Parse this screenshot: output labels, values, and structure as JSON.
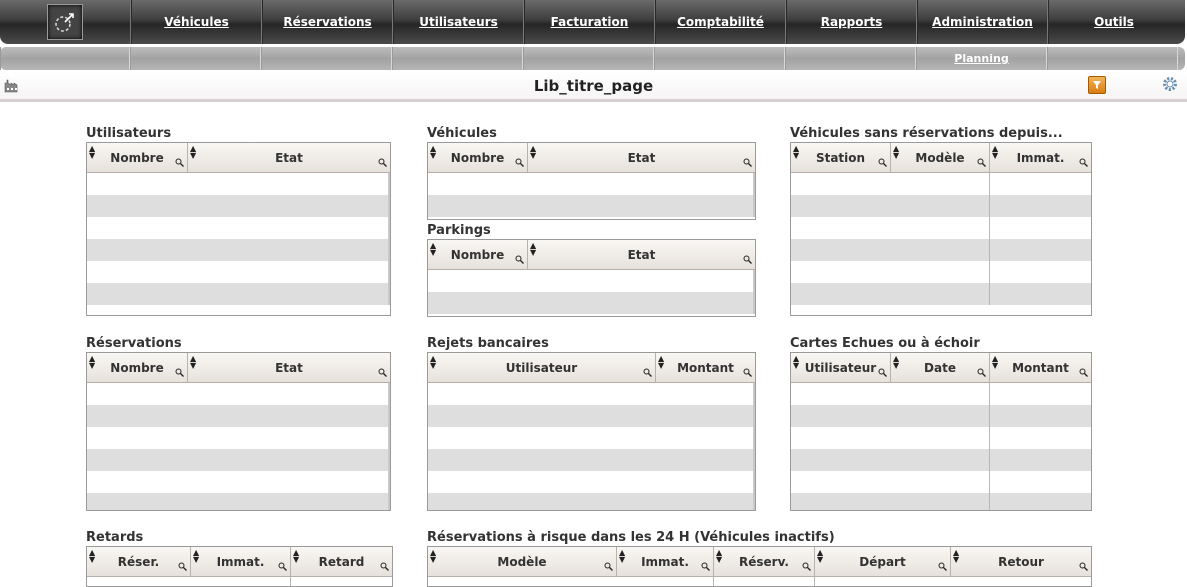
{
  "nav": {
    "items": [
      "Véhicules",
      "Réservations",
      "Utilisateurs",
      "Facturation",
      "Comptabilité",
      "Rapports",
      "Administration",
      "Outils"
    ]
  },
  "subnav": {
    "planning": "Planning"
  },
  "page": {
    "title": "Lib_titre_page"
  },
  "panels": {
    "utilisateurs": {
      "title": "Utilisateurs",
      "cols": [
        "Nombre",
        "Etat"
      ]
    },
    "vehicules": {
      "title": "Véhicules",
      "cols": [
        "Nombre",
        "Etat"
      ]
    },
    "parkings": {
      "title": "Parkings",
      "cols": [
        "Nombre",
        "Etat"
      ]
    },
    "sans_resa": {
      "title": "Véhicules sans réservations depuis...",
      "cols": [
        "Station",
        "Modèle",
        "Immat."
      ]
    },
    "reservations": {
      "title": "Réservations",
      "cols": [
        "Nombre",
        "Etat"
      ]
    },
    "rejets": {
      "title": "Rejets bancaires",
      "cols": [
        "Utilisateur",
        "Montant"
      ]
    },
    "cartes": {
      "title": "Cartes Echues ou à échoir",
      "cols": [
        "Utilisateur",
        "Date",
        "Montant"
      ]
    },
    "retards": {
      "title": "Retards",
      "cols": [
        "Réser.",
        "Immat.",
        "Retard"
      ]
    },
    "risque": {
      "title": "Réservations à risque dans les 24 H (Véhicules inactifs)",
      "cols": [
        "Modèle",
        "Immat.",
        "Réserv.",
        "Départ",
        "Retour"
      ]
    }
  }
}
